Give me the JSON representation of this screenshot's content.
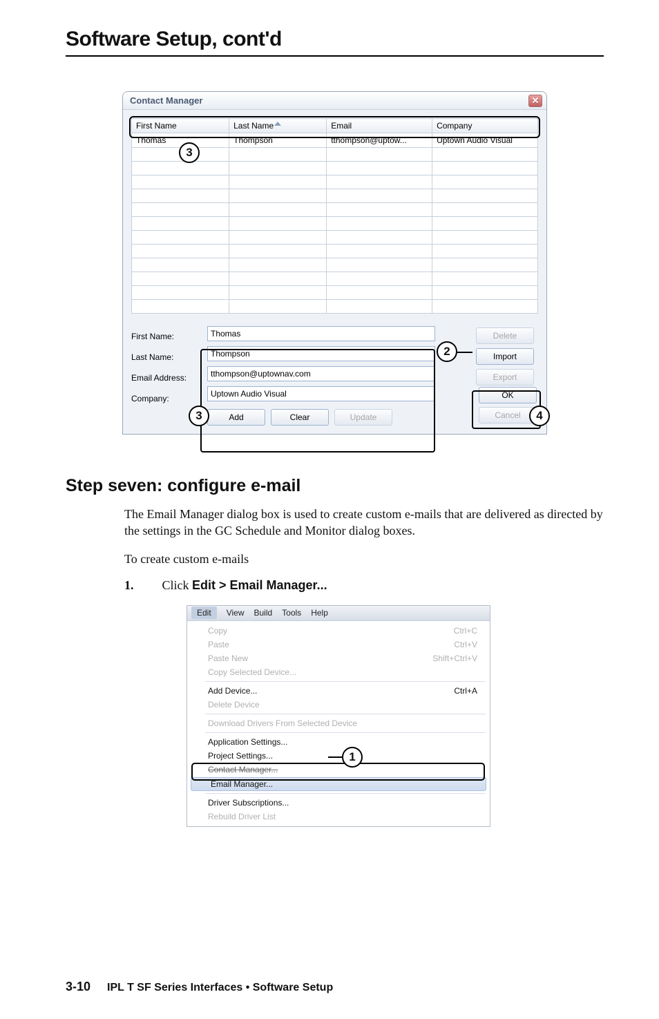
{
  "page": {
    "title": "Software Setup, cont'd",
    "step_heading": "Step seven: configure e-mail",
    "para1": "The Email Manager dialog box is used to create custom e-mails that are delivered as directed by the settings in the GC Schedule and Monitor dialog boxes.",
    "para2": "To create custom e-mails",
    "step1_text": "Click ",
    "step1_bold": "Edit > Email Manager...",
    "footer_page": "3-10",
    "footer_text": "IPL T SF Series Interfaces • Software Setup"
  },
  "callouts": {
    "n2": "2",
    "n3": "3",
    "n4": "4",
    "menu1": "1"
  },
  "dialog": {
    "title": "Contact Manager",
    "columns": {
      "first": "First Name",
      "last": "Last Name",
      "email": "Email",
      "company": "Company"
    },
    "row": {
      "first": "Thomas",
      "last": "Thompson",
      "email": "tthompson@uptow...",
      "company": "Uptown Audio Visual"
    },
    "labels": {
      "first": "First Name:",
      "last": "Last Name:",
      "email": "Email Address:",
      "company": "Company:"
    },
    "inputs": {
      "first": "Thomas",
      "last": "Thompson",
      "email": "tthompson@uptownav.com",
      "company": "Uptown Audio Visual"
    },
    "buttons": {
      "delete": "Delete",
      "import": "Import",
      "export": "Export",
      "add": "Add",
      "clear": "Clear",
      "update": "Update",
      "ok": "OK",
      "cancel": "Cancel"
    }
  },
  "menu": {
    "bar": [
      "Edit",
      "View",
      "Build",
      "Tools",
      "Help"
    ],
    "items": {
      "copy": "Copy",
      "copy_sc": "Ctrl+C",
      "paste": "Paste",
      "paste_sc": "Ctrl+V",
      "pastenew": "Paste New",
      "pastenew_sc": "Shift+Ctrl+V",
      "copysel": "Copy Selected Device...",
      "adddev": "Add Device...",
      "adddev_sc": "Ctrl+A",
      "deldev": "Delete Device",
      "dldrv": "Download Drivers From Selected Device",
      "appset": "Application Settings...",
      "projset": "Project Settings...",
      "contact": "Contact Manager...",
      "emailmgr": "Email Manager...",
      "drvsub": "Driver Subscriptions...",
      "rebuild": "Rebuild Driver List"
    }
  }
}
